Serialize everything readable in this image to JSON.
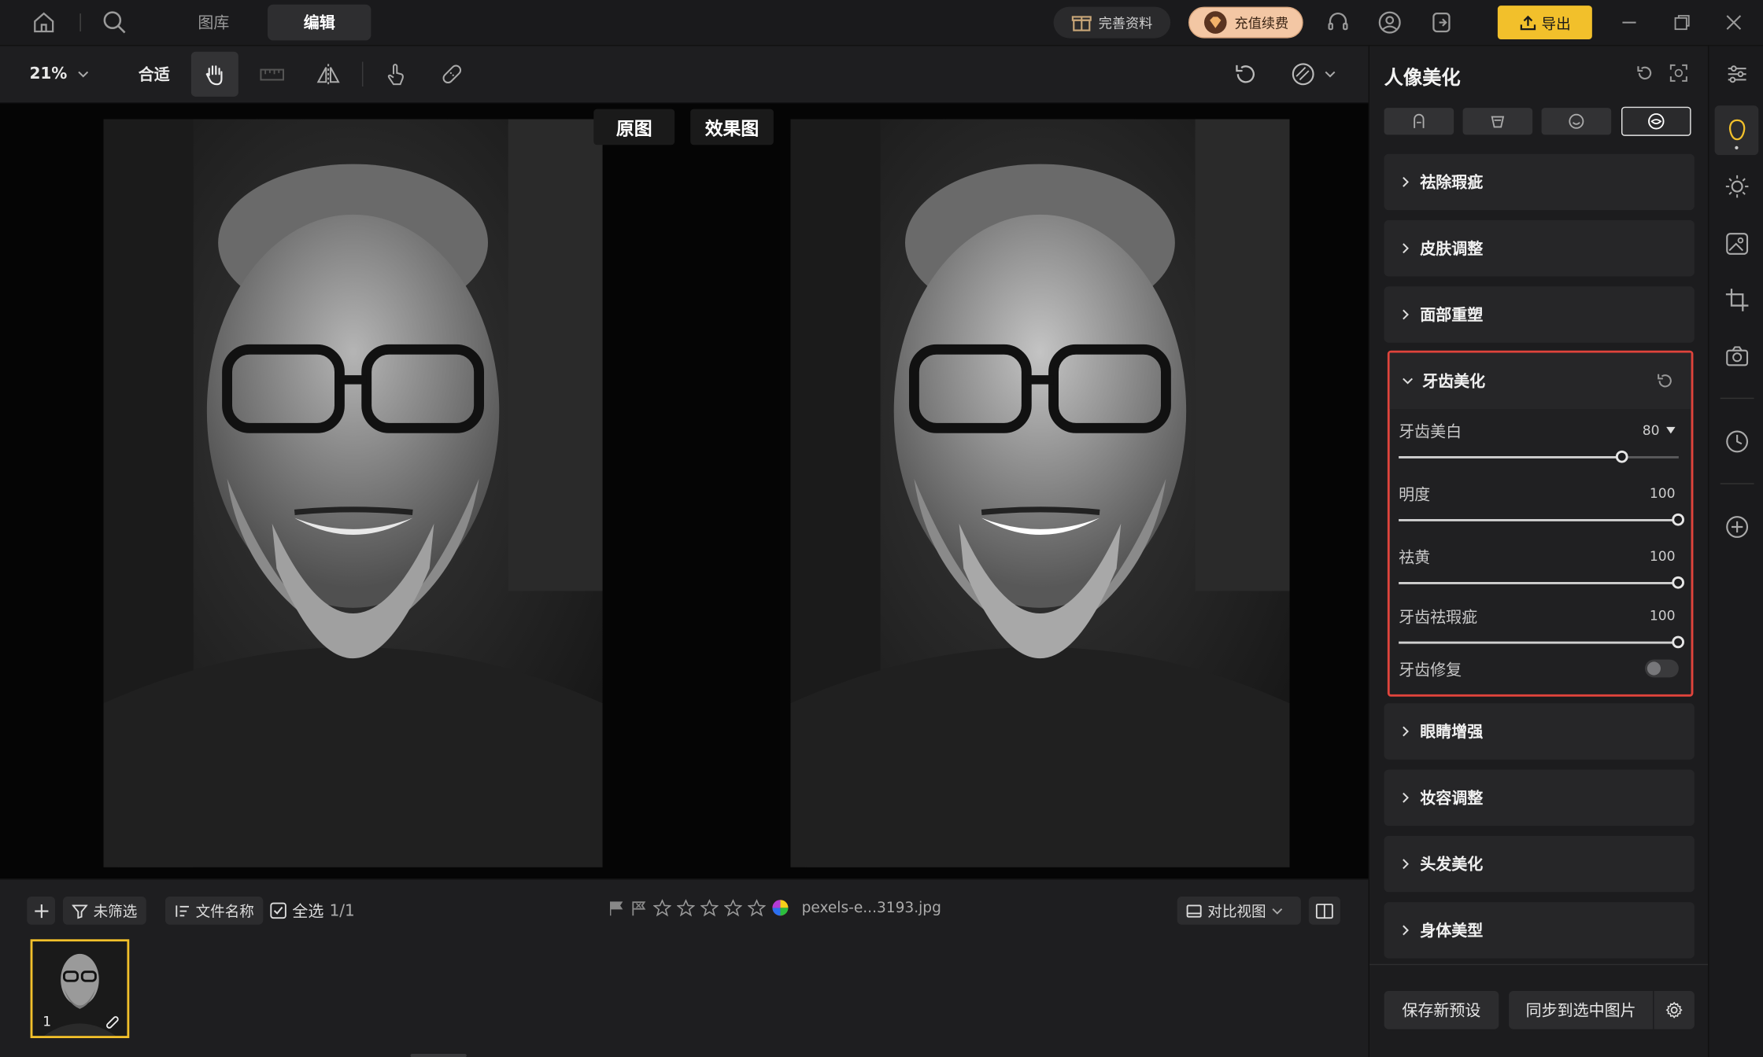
{
  "titlebar": {
    "tabs": [
      {
        "label": "图库"
      },
      {
        "label": "编辑"
      }
    ],
    "profile_label": "完善资料",
    "recharge_label": "充值续费",
    "export_label": "导出"
  },
  "toolbar": {
    "zoom": "21%",
    "fit_label": "合适"
  },
  "canvas": {
    "original_label": "原图",
    "effect_label": "效果图"
  },
  "bottombar": {
    "filter_label": "未筛选",
    "sort_label": "文件名称",
    "select_all_label": "全选",
    "select_count": "1/1",
    "filename": "pexels-e...3193.jpg",
    "compare_view_label": "对比视图",
    "rating_stars": 0,
    "thumb_index": "1"
  },
  "panel": {
    "title": "人像美化",
    "sections_top": [
      {
        "label": "祛除瑕疵"
      },
      {
        "label": "皮肤调整"
      },
      {
        "label": "面部重塑"
      }
    ],
    "teeth": {
      "label": "牙齿美化",
      "sliders": [
        {
          "label": "牙齿美白",
          "value": "80",
          "fraction": 0.8
        },
        {
          "label": "明度",
          "value": "100",
          "fraction": 1.0
        },
        {
          "label": "祛黄",
          "value": "100",
          "fraction": 1.0
        },
        {
          "label": "牙齿祛瑕疵",
          "value": "100",
          "fraction": 1.0
        }
      ],
      "repair_label": "牙齿修复",
      "repair_on": false
    },
    "sections_bottom": [
      {
        "label": "眼睛增强"
      },
      {
        "label": "妆容调整"
      },
      {
        "label": "头发美化"
      },
      {
        "label": "身体美型"
      }
    ],
    "save_preset_label": "保存新预设",
    "sync_label": "同步到选中图片"
  },
  "colors": {
    "accent_yellow": "#f2c02b",
    "highlight_red": "#e0443c",
    "recharge_bg": "#f3c7a4"
  }
}
